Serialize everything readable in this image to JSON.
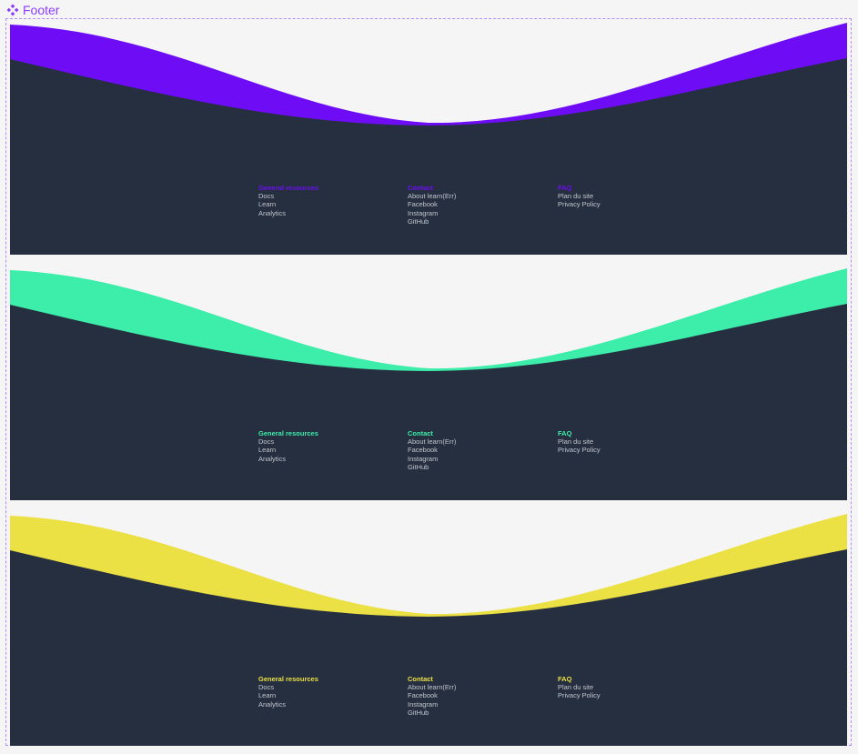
{
  "frame": {
    "title": "Footer"
  },
  "colors": {
    "background": "#f5f5f5",
    "footer_body": "#252f3f",
    "frame_accent": "#8b3dff",
    "link_text": "#c3c7d0"
  },
  "variants": [
    {
      "accent": "#6e0df5",
      "columns": [
        {
          "title": "General resources",
          "links": [
            "Docs",
            "Learn",
            "Analytics"
          ]
        },
        {
          "title": "Contact",
          "links": [
            "About learn(Err)",
            "Facebook",
            "Instagram",
            "GitHub"
          ]
        },
        {
          "title": "FAQ",
          "links": [
            "Plan du site",
            "Privacy Policy"
          ]
        }
      ]
    },
    {
      "accent": "#3dedaa",
      "columns": [
        {
          "title": "General resources",
          "links": [
            "Docs",
            "Learn",
            "Analytics"
          ]
        },
        {
          "title": "Contact",
          "links": [
            "About learn(Err)",
            "Facebook",
            "Instagram",
            "GitHub"
          ]
        },
        {
          "title": "FAQ",
          "links": [
            "Plan du site",
            "Privacy Policy"
          ]
        }
      ]
    },
    {
      "accent": "#ebe044",
      "columns": [
        {
          "title": "General resources",
          "links": [
            "Docs",
            "Learn",
            "Analytics"
          ]
        },
        {
          "title": "Contact",
          "links": [
            "About learn(Err)",
            "Facebook",
            "Instagram",
            "GitHub"
          ]
        },
        {
          "title": "FAQ",
          "links": [
            "Plan du site",
            "Privacy Policy"
          ]
        }
      ]
    }
  ]
}
